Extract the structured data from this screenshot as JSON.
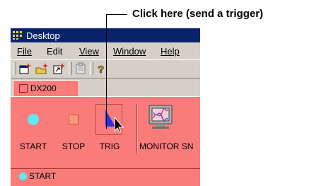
{
  "callout": {
    "text": "Click here (send a trigger)"
  },
  "window": {
    "title": "Desktop"
  },
  "menu": [
    {
      "label": "File"
    },
    {
      "label": "Edit"
    },
    {
      "label": "View"
    },
    {
      "label": "Window"
    },
    {
      "label": "Help"
    }
  ],
  "toolbar": {
    "icons": [
      "new-window-icon",
      "new-layout-icon",
      "arrow-icon",
      "properties-icon",
      "help-icon"
    ]
  },
  "tab": {
    "label": "DX200"
  },
  "buttons": {
    "start": "START",
    "stop": "STOP",
    "trig": "TRIG",
    "monitor": "MONITOR SN"
  },
  "status": {
    "label": "START"
  },
  "colors": {
    "panel": "#fa7c7a",
    "titlebar": "#09246b",
    "start": "#5fe9f1",
    "trig": "#2f2fe8"
  }
}
